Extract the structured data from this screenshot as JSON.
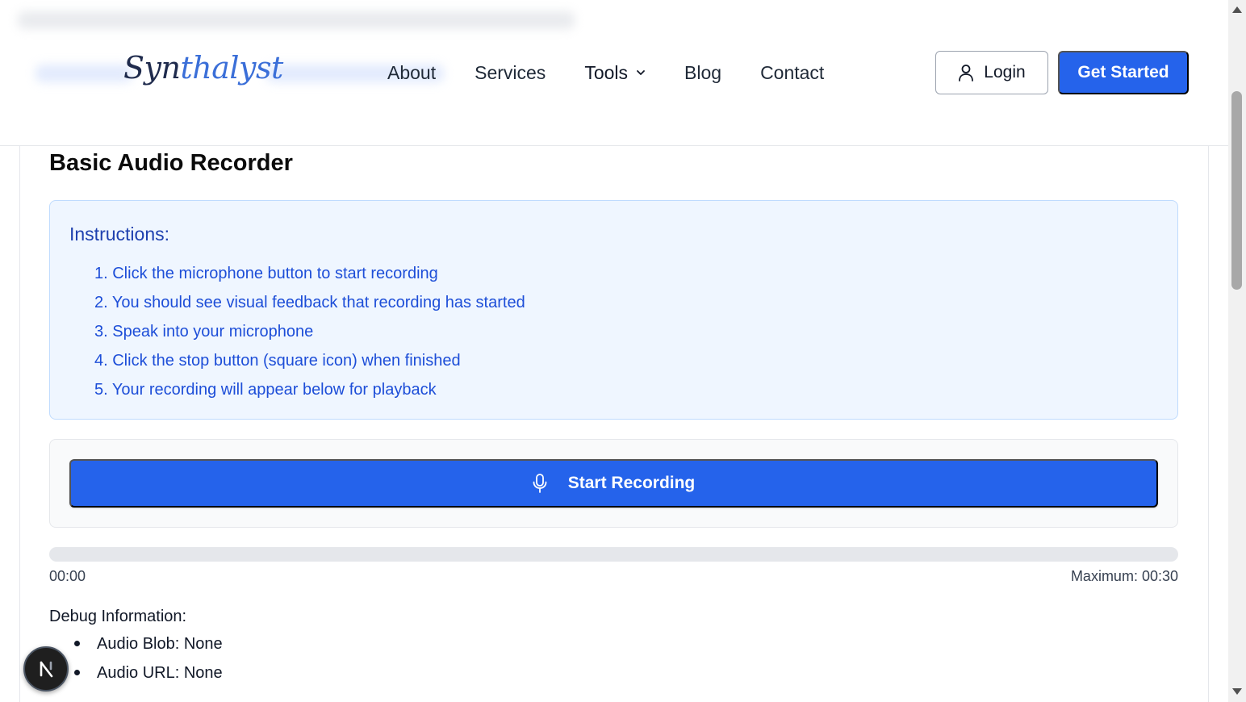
{
  "header": {
    "logo_prefix": "Syn",
    "logo_highlight": "thalyst",
    "nav": [
      {
        "label": "About"
      },
      {
        "label": "Services"
      },
      {
        "label": "Tools"
      },
      {
        "label": "Blog"
      },
      {
        "label": "Contact"
      }
    ],
    "login_label": "Login",
    "cta_label": "Get Started"
  },
  "page": {
    "title": "Basic Audio Recorder"
  },
  "instructions": {
    "heading": "Instructions:",
    "steps": [
      "1. Click the microphone button to start recording",
      "2. You should see visual feedback that recording has started",
      "3. Speak into your microphone",
      "4. Click the stop button (square icon) when finished",
      "5. Your recording will appear below for playback"
    ]
  },
  "recorder": {
    "button_label": "Start Recording",
    "progress_fraction": 0,
    "current_time": "00:00",
    "max_time": "Maximum: 00:30"
  },
  "debug": {
    "title": "Debug Information:",
    "items": [
      "Audio Blob: None",
      "Audio URL: None"
    ]
  },
  "colors": {
    "primary": "#2563eb",
    "instructions_bg": "#eff6ff",
    "instructions_text": "#1d4ed8"
  },
  "icons": {
    "login": "user-icon",
    "tools": "chevron-down-icon",
    "record": "microphone-icon",
    "badge": "nextjs-logo-icon"
  }
}
